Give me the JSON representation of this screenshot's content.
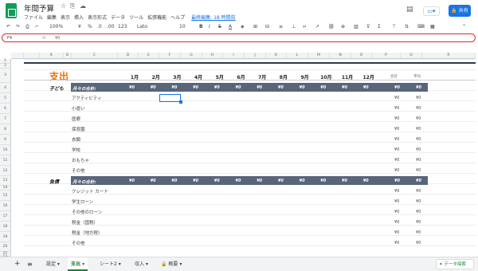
{
  "app": {
    "title": "年間予算",
    "menu": [
      "ファイル",
      "編集",
      "表示",
      "挿入",
      "表示形式",
      "データ",
      "ツール",
      "拡張機能",
      "ヘルプ"
    ],
    "last_edit": "最終編集: 18 時間前",
    "share_label": "共有",
    "accent": "#1a73e8",
    "brand": "#0f9d58"
  },
  "toolbar": {
    "zoom": "100%",
    "currency": "¥",
    "percent": "%",
    "decimals_dec": ".0",
    "decimals_inc": ".00",
    "format_more": "123",
    "font": "Lato",
    "font_size": "10",
    "bold": "B",
    "italic": "I",
    "strike": "S",
    "text_color": "A"
  },
  "formula_bar": {
    "cell_ref": "F4",
    "fx": "fx",
    "value": "¥0"
  },
  "columns": [
    "",
    "",
    "K",
    "B",
    "C",
    "D",
    "E",
    "F",
    "G",
    "H",
    "I",
    "J",
    "K",
    "L",
    "M",
    "N",
    "O",
    "P",
    "Q",
    "R"
  ],
  "rows": [
    "1",
    "2",
    "3",
    "4",
    "5",
    "6",
    "7",
    "8",
    "9",
    "10",
    "11",
    "12",
    "13",
    "14",
    "15",
    "16",
    "17",
    "18",
    "19",
    "20",
    "21",
    "22"
  ],
  "sheet": {
    "title": "支出",
    "months": [
      "1月",
      "2月",
      "3月",
      "4月",
      "5月",
      "6月",
      "7月",
      "8月",
      "9月",
      "10月",
      "11月",
      "12月"
    ],
    "col_total_a": "合計",
    "col_total_b": "平均",
    "sections": [
      {
        "category": "子ども",
        "total_label": "月々の合計:",
        "items": [
          "アクティビティ",
          "小遣い",
          "医療",
          "保育園",
          "衣類",
          "学校",
          "おもちゃ",
          "その他"
        ]
      },
      {
        "category": "負債",
        "total_label": "月々の合計:",
        "items": [
          "クレジット カード",
          "学生ローン",
          "その他のローン",
          "税金（国税）",
          "税金（地方税）",
          "その他"
        ]
      }
    ],
    "zero": "¥0"
  },
  "tabs": {
    "add": "+",
    "list": "≡",
    "items": [
      "設定",
      "支出",
      "シート2",
      "収入",
      "概要"
    ],
    "active": "支出",
    "explore": "データ探索"
  }
}
